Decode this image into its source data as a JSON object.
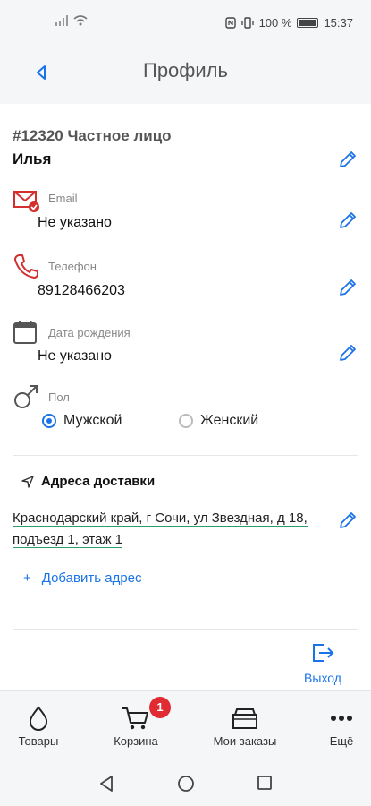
{
  "status_bar": {
    "battery": "100 %",
    "time": "15:37"
  },
  "header": {
    "title": "Профиль"
  },
  "profile": {
    "id_line": "#12320 Частное лицо",
    "name": "Илья"
  },
  "fields": {
    "email": {
      "label": "Email",
      "value": "Не указано"
    },
    "phone": {
      "label": "Телефон",
      "value": "89128466203"
    },
    "birthdate": {
      "label": "Дата рождения",
      "value": "Не указано"
    },
    "gender": {
      "label": "Пол",
      "options": [
        "Мужской",
        "Женский"
      ],
      "selected": "Мужской"
    }
  },
  "delivery": {
    "title": "Адреса доставки",
    "addresses": [
      "Краснодарский край, г Сочи, ул Звездная, д 18, подъезд 1, этаж 1"
    ],
    "add_label": "Добавить адрес",
    "add_symbol": "+"
  },
  "logout_label": "Выход",
  "tabbar": {
    "items": [
      {
        "label": "Товары",
        "icon": "drop-icon"
      },
      {
        "label": "Корзина",
        "icon": "cart-icon",
        "badge": "1"
      },
      {
        "label": "Мои заказы",
        "icon": "box-icon"
      },
      {
        "label": "Ещё",
        "icon": "more-icon"
      }
    ]
  },
  "colors": {
    "accent": "#1a73e8",
    "badge": "#e02b33",
    "email_icon": "#d32f2f",
    "underline": "#2e9c6a"
  }
}
